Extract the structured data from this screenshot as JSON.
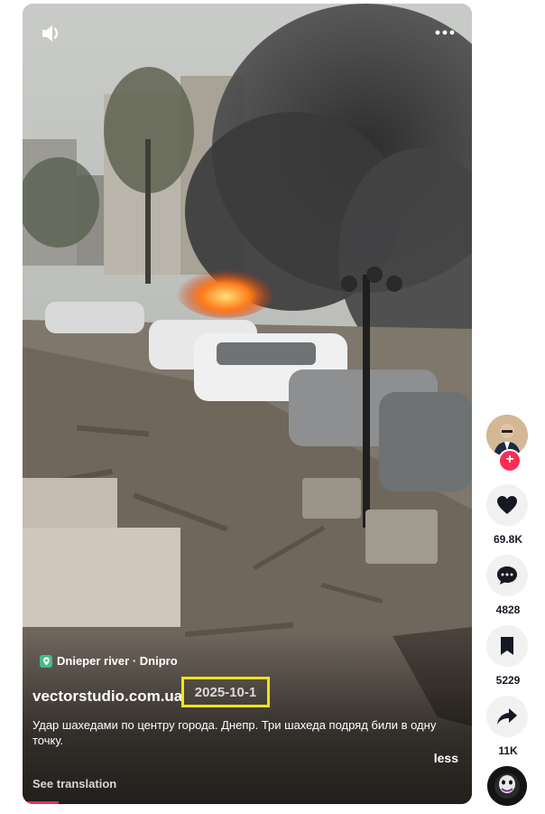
{
  "video": {
    "location": "Dnieper river · Dnipro",
    "author": "vectorstudio.com.ua",
    "date": "2025-10-1",
    "caption": "Удар шахедами по центру города. Днепр. Три шахеда подряд били в одну точку.",
    "less_label": "less",
    "see_translation_label": "See translation",
    "progress": 0.08
  },
  "sidebar": {
    "likes": "69.8K",
    "comments": "4828",
    "saves": "5229",
    "shares": "11K"
  },
  "colors": {
    "accent": "#fe2c55",
    "highlight": "#f1e21c"
  }
}
